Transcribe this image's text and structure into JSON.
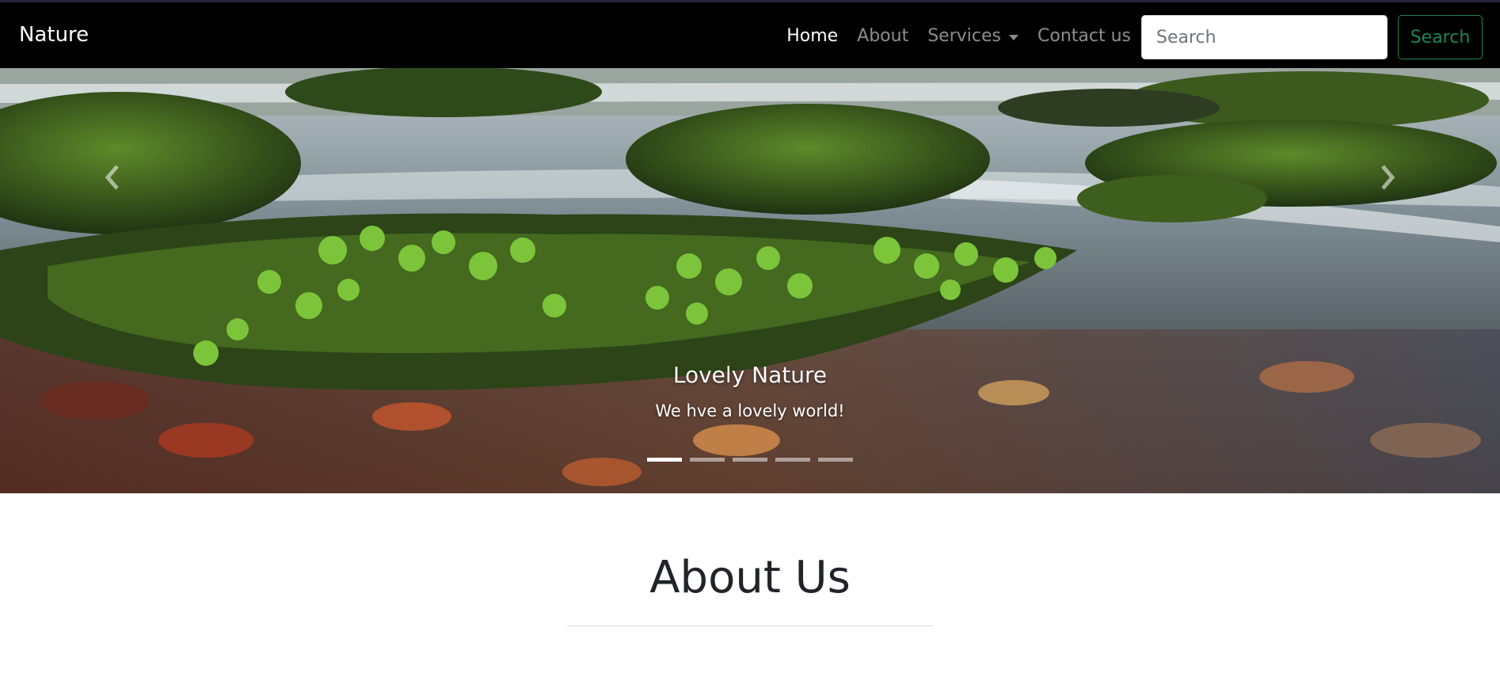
{
  "navbar": {
    "brand": "Nature",
    "links": [
      {
        "label": "Home",
        "active": true
      },
      {
        "label": "About",
        "active": false
      },
      {
        "label": "Services",
        "active": false,
        "dropdown": true
      },
      {
        "label": "Contact us",
        "active": false
      }
    ],
    "search": {
      "placeholder": "Search",
      "value": "",
      "button_label": "Search"
    }
  },
  "carousel": {
    "caption_title": "Lovely Nature",
    "caption_text": "We hve a lovely world!",
    "slide_count": 5,
    "active_slide": 1,
    "prev_icon": "chevron-left-icon",
    "next_icon": "chevron-right-icon"
  },
  "about": {
    "heading": "About Us"
  },
  "colors": {
    "navbar_bg": "#000000",
    "link_active": "#ffffff",
    "link_inactive": "#8c8c8c",
    "search_button": "#198754",
    "heading_text": "#212529"
  }
}
